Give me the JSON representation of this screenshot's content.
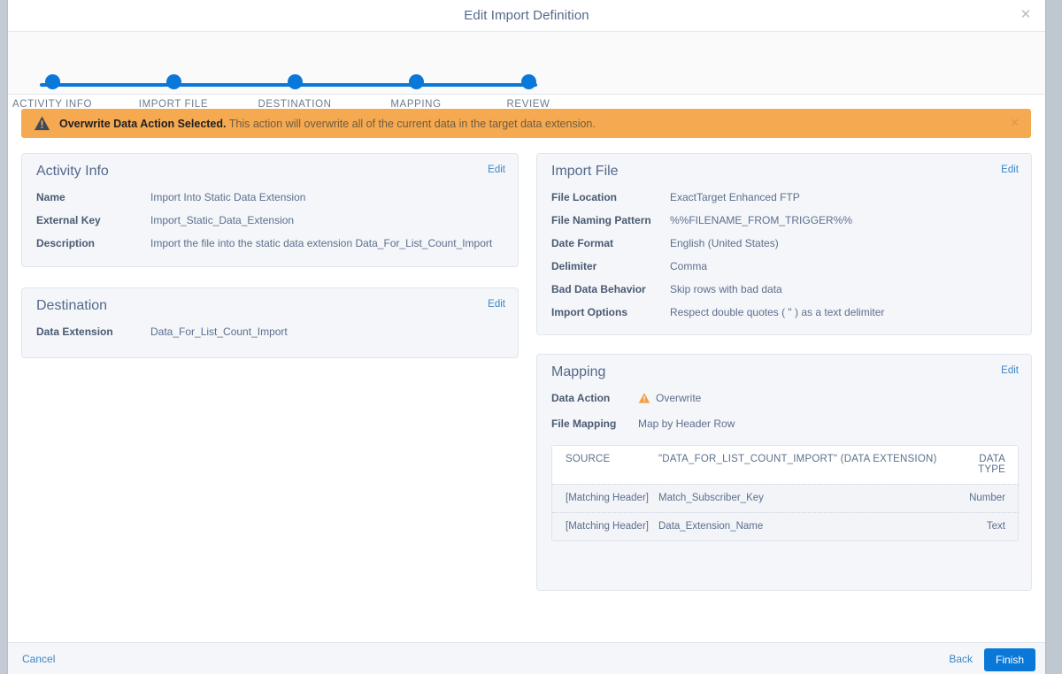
{
  "window": {
    "title": "Edit Import Definition",
    "close_label": "✕"
  },
  "wizard": {
    "steps": [
      {
        "label": "ACTIVITY INFO"
      },
      {
        "label": "IMPORT FILE"
      },
      {
        "label": "DESTINATION"
      },
      {
        "label": "MAPPING"
      },
      {
        "label": "REVIEW"
      }
    ],
    "accent_color": "#0a78d8"
  },
  "banner": {
    "icon": "warning-triangle-icon",
    "strong": "Overwrite Data Action Selected.",
    "message": "This action will overwrite all of the current data in the target data extension.",
    "close_label": "✕",
    "background_color": "#f5a951"
  },
  "cards": {
    "activity_info": {
      "title": "Activity Info",
      "edit_label": "Edit",
      "rows": [
        {
          "label": "Name",
          "value": "Import Into Static Data Extension"
        },
        {
          "label": "External Key",
          "value": "Import_Static_Data_Extension"
        },
        {
          "label": "Description",
          "value": "Import the file into the static data extension Data_For_List_Count_Import"
        }
      ]
    },
    "destination": {
      "title": "Destination",
      "edit_label": "Edit",
      "rows": [
        {
          "label": "Data Extension",
          "value": "Data_For_List_Count_Import"
        }
      ]
    },
    "import_file": {
      "title": "Import File",
      "edit_label": "Edit",
      "rows": [
        {
          "label": "File Location",
          "value": "ExactTarget Enhanced FTP"
        },
        {
          "label": "File Naming Pattern",
          "value": "%%FILENAME_FROM_TRIGGER%%"
        },
        {
          "label": "Date Format",
          "value": "English (United States)"
        },
        {
          "label": "Delimiter",
          "value": "Comma"
        },
        {
          "label": "Bad Data Behavior",
          "value": "Skip rows with bad data"
        },
        {
          "label": "Import Options",
          "value": "Respect double quotes ( \" ) as a text delimiter"
        }
      ]
    },
    "mapping": {
      "title": "Mapping",
      "edit_label": "Edit",
      "data_action_label": "Data Action",
      "data_action_value": "Overwrite",
      "data_action_icon": "warning-triangle-icon",
      "file_mapping_label": "File Mapping",
      "file_mapping_value": "Map by Header Row",
      "table": {
        "headers": {
          "source": "SOURCE",
          "target": "\"DATA_FOR_LIST_COUNT_IMPORT\" (DATA EXTENSION)",
          "type": "DATA TYPE"
        },
        "rows": [
          {
            "source": "[Matching Header]",
            "target": "Match_Subscriber_Key",
            "type": "Number"
          },
          {
            "source": "[Matching Header]",
            "target": "Data_Extension_Name",
            "type": "Text"
          }
        ]
      }
    }
  },
  "footer": {
    "cancel_label": "Cancel",
    "back_label": "Back",
    "finish_label": "Finish"
  }
}
